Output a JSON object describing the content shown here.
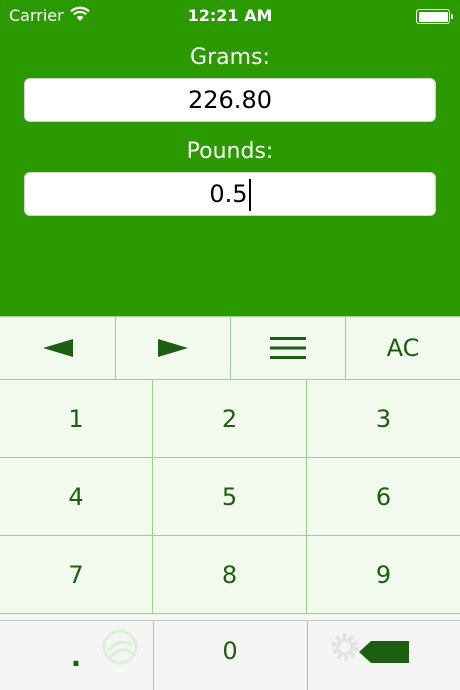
{
  "status_bar": {
    "carrier": "Carrier",
    "time": "12:21 AM"
  },
  "converter": {
    "grams_label": "Grams:",
    "grams_value": "226.80",
    "pounds_label": "Pounds:",
    "pounds_value": "0.5"
  },
  "keypad": {
    "left_arrow": "◄",
    "right_arrow": "►",
    "menu": "☰",
    "clear": "AC",
    "keys": [
      "1",
      "2",
      "3",
      "4",
      "5",
      "6",
      "7",
      "8",
      "9"
    ],
    "decimal": ".",
    "zero": "0"
  },
  "tabbar": {
    "tab_left_label": "",
    "tab_right_label": ""
  },
  "colors": {
    "background": "#2a9a00",
    "key_text": "#1c5f10",
    "key_bg": "#f2faee",
    "key_line": "#9ad08a"
  }
}
